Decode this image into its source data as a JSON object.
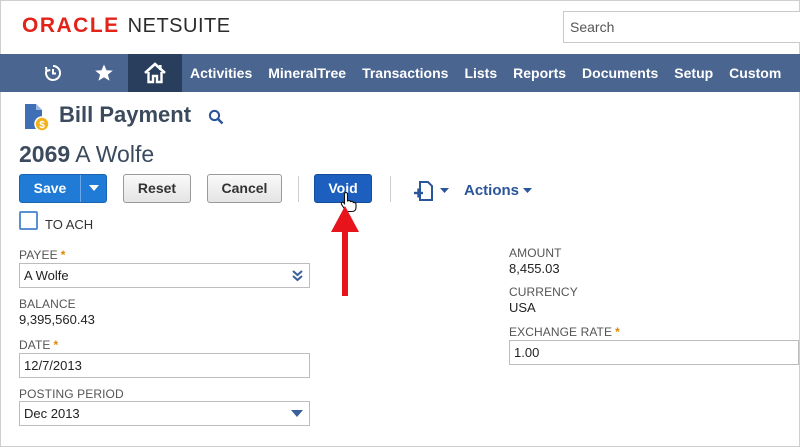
{
  "header": {
    "logo_oracle": "ORACLE",
    "logo_netsuite": "NETSUITE",
    "search_placeholder": "Search"
  },
  "nav": {
    "items": [
      "Activities",
      "MineralTree",
      "Transactions",
      "Lists",
      "Reports",
      "Documents",
      "Setup",
      "Custom"
    ]
  },
  "page": {
    "title": "Bill Payment",
    "record_number": "2069",
    "record_name": "A Wolfe"
  },
  "toolbar": {
    "save": "Save",
    "reset": "Reset",
    "cancel": "Cancel",
    "void": "Void",
    "actions": "Actions"
  },
  "form": {
    "to_ach_label": "TO ACH",
    "payee_label": "PAYEE",
    "payee_value": "A Wolfe",
    "balance_label": "BALANCE",
    "balance_value": "9,395,560.43",
    "date_label": "DATE",
    "date_value": "12/7/2013",
    "posting_period_label": "POSTING PERIOD",
    "posting_period_value": "Dec 2013",
    "amount_label": "AMOUNT",
    "amount_value": "8,455.03",
    "currency_label": "CURRENCY",
    "currency_value": "USA",
    "exchange_rate_label": "EXCHANGE RATE",
    "exchange_rate_value": "1.00",
    "required_mark": "*"
  },
  "colors": {
    "oracle_red": "#e2231a",
    "nav_bg": "#4a6590",
    "nav_active": "#293d5c",
    "save_blue": "#1f7bd6",
    "void_blue": "#1d5fbf",
    "required_orange": "#e08a00",
    "annotation_red": "#e8141b"
  },
  "icons": {
    "recent": "clock-icon",
    "favorites": "star-icon",
    "home": "home-icon",
    "record": "document-icon",
    "title_search": "search-icon",
    "new_record": "new-document-icon",
    "cursor": "hand-cursor-icon"
  }
}
